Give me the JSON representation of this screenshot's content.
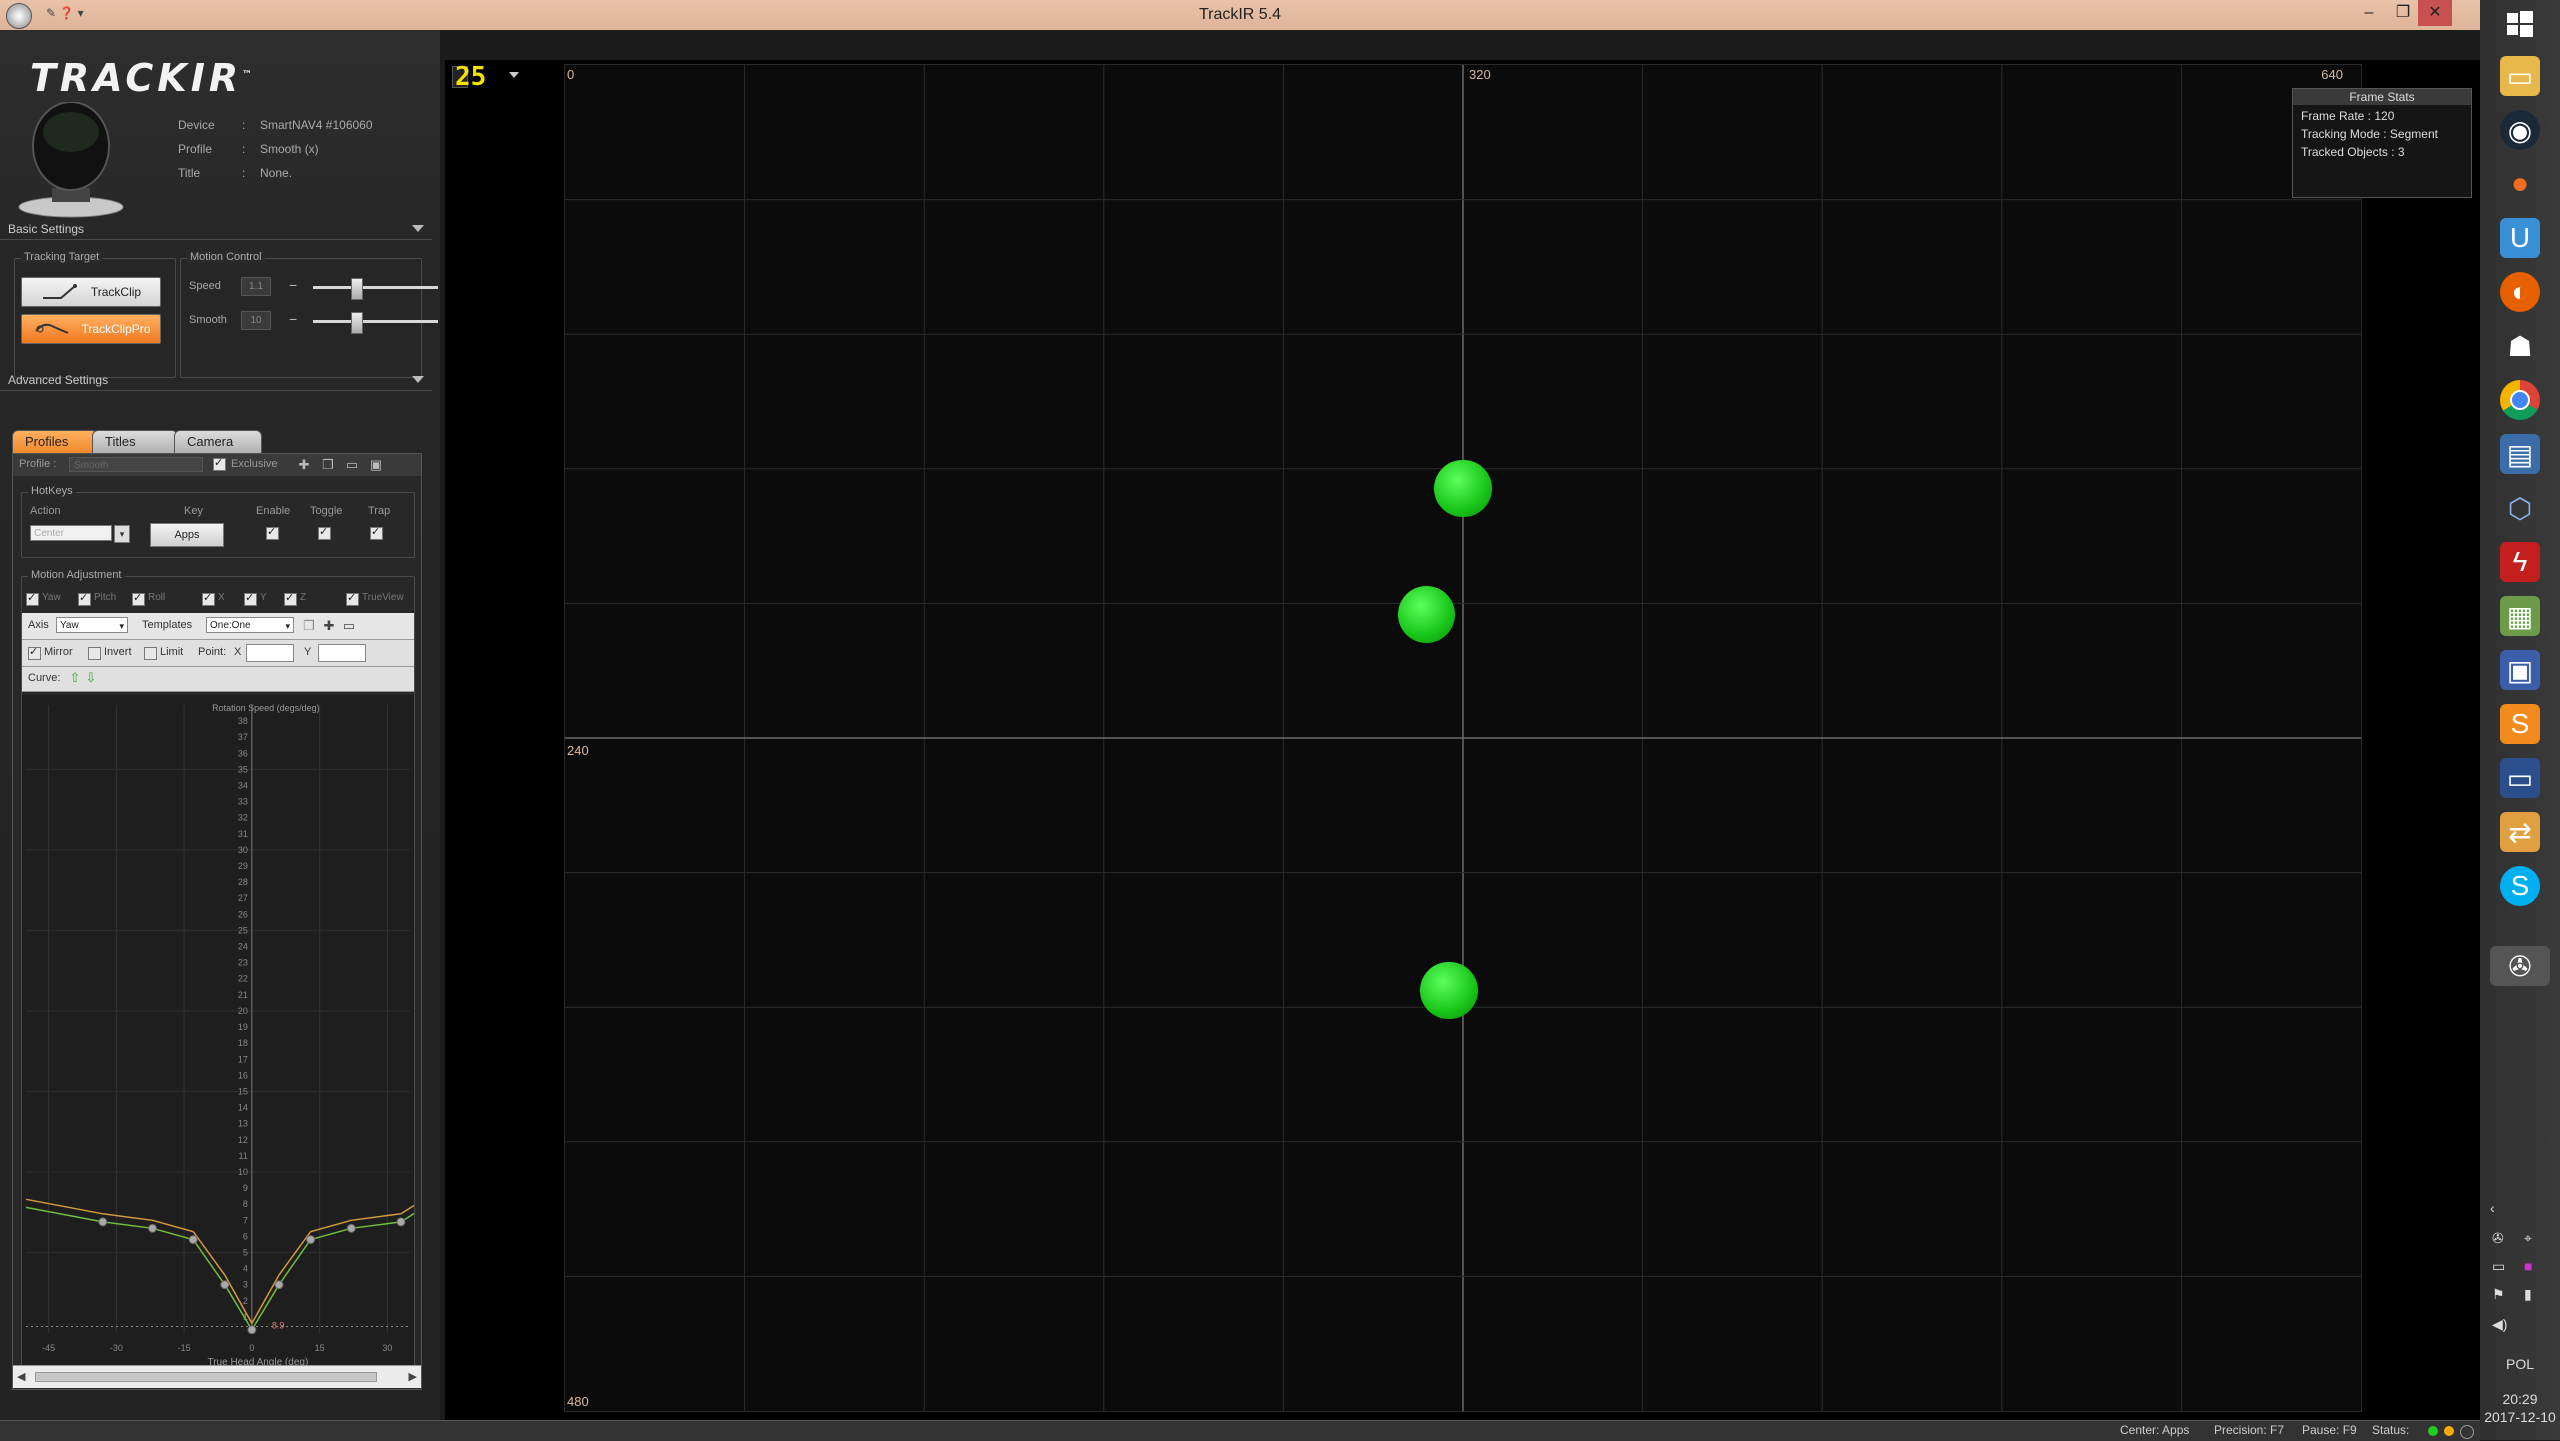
{
  "window": {
    "title": "TrackIR 5.4",
    "minimize": "–",
    "maximize": "❐",
    "close": "✕"
  },
  "app": {
    "logo": "TRACKIR",
    "logo_tm": "™",
    "device_label": "Device",
    "device_value": "SmartNAV4 #106060",
    "profile_label": "Profile",
    "profile_value": "Smooth (x)",
    "title_label": "Title",
    "title_value": "None.",
    "sep": ":"
  },
  "basic_settings": {
    "header": "Basic Settings",
    "tracking_target_title": "Tracking Target",
    "trackclip": "TrackClip",
    "trackclippro": "TrackClipPro",
    "motion_control_title": "Motion Control",
    "speed_label": "Speed",
    "speed_value": "1.1",
    "speed_level": 0.3,
    "smooth_label": "Smooth",
    "smooth_value": "10",
    "smooth_level": 0.3
  },
  "advanced_settings": {
    "header": "Advanced Settings",
    "tabs": [
      "Profiles",
      "Titles",
      "Camera"
    ],
    "profile_label": "Profile :",
    "profile_value": "Smooth",
    "exclusive_label": "Exclusive",
    "hotkeys": {
      "title": "HotKeys",
      "col_action": "Action",
      "col_key": "Key",
      "col_enable": "Enable",
      "col_toggle": "Toggle",
      "col_trap": "Trap",
      "action_value": "Center",
      "key_value": "Apps"
    },
    "motion_adjustment": {
      "title": "Motion Adjustment",
      "axes": [
        "Yaw",
        "Pitch",
        "Roll",
        "X",
        "Y",
        "Z",
        "TrueView"
      ],
      "axis_label": "Axis",
      "axis_value": "Yaw",
      "templates_label": "Templates",
      "templates_value": "One:One",
      "mirror": "Mirror",
      "invert": "Invert",
      "limit": "Limit",
      "point_label": "Point:",
      "x_label": "X",
      "y_label": "Y",
      "curve_label": "Curve:"
    }
  },
  "chart_data": {
    "type": "line",
    "title": "Rotation Speed (degs/deg)",
    "xlabel": "True Head Angle (deg)",
    "ylabel": "",
    "xlim": [
      -50,
      35
    ],
    "ylim": [
      0,
      39
    ],
    "x_ticks": [
      -45,
      -30,
      -15,
      0,
      15,
      30
    ],
    "y_ticks": [
      1,
      2,
      3,
      4,
      5,
      6,
      7,
      8,
      9,
      10,
      11,
      12,
      13,
      14,
      15,
      16,
      17,
      18,
      19,
      20,
      21,
      22,
      23,
      24,
      25,
      26,
      27,
      28,
      29,
      30,
      31,
      32,
      33,
      34,
      35,
      36,
      37,
      38
    ],
    "series": [
      {
        "x": [
          -50,
          -33,
          -22,
          -13,
          -6,
          0,
          6,
          13,
          22,
          33,
          38
        ],
        "y": [
          7.8,
          6.9,
          6.5,
          5.8,
          3.0,
          0.2,
          3.0,
          5.8,
          6.5,
          6.9,
          7.8
        ],
        "color": "#6fbf3a"
      },
      {
        "x": [
          -50,
          -33,
          -22,
          -13,
          -6,
          0,
          6,
          13,
          22,
          33,
          38
        ],
        "y": [
          8.3,
          7.4,
          7.0,
          6.3,
          3.6,
          0.6,
          3.6,
          6.3,
          7.0,
          7.4,
          8.3
        ],
        "color": "#d49a3a"
      }
    ],
    "points": [
      {
        "x": -33,
        "y": 6.9
      },
      {
        "x": -22,
        "y": 6.5
      },
      {
        "x": -13,
        "y": 5.8
      },
      {
        "x": -6,
        "y": 3.0
      },
      {
        "x": 0,
        "y": 0.2
      },
      {
        "x": 6,
        "y": 3.0
      },
      {
        "x": 13,
        "y": 5.8
      },
      {
        "x": 22,
        "y": 6.5
      },
      {
        "x": 33,
        "y": 6.9
      }
    ],
    "annotation": "8.9"
  },
  "view": {
    "fps_value": "25",
    "x_left": "0",
    "x_mid": "320",
    "x_right": "640",
    "y_mid": "240",
    "y_bottom": "480",
    "frame_stats_title": "Frame Stats",
    "frame_rate": "Frame Rate : 120",
    "tracking_mode": "Tracking Mode : Segment",
    "tracked_objects": "Tracked Objects : 3",
    "blobs": [
      {
        "x": 320,
        "y": 151,
        "d": 24
      },
      {
        "x": 307,
        "y": 196,
        "d": 24
      },
      {
        "x": 315,
        "y": 330,
        "d": 24
      }
    ]
  },
  "statusbar": {
    "center": "Center: Apps",
    "precision": "Precision: F7",
    "pause": "Pause: F9",
    "status": "Status:"
  },
  "taskbar": {
    "lang": "POL",
    "time": "20:29",
    "date": "2017-12-10",
    "tray_arrow": "‹"
  }
}
